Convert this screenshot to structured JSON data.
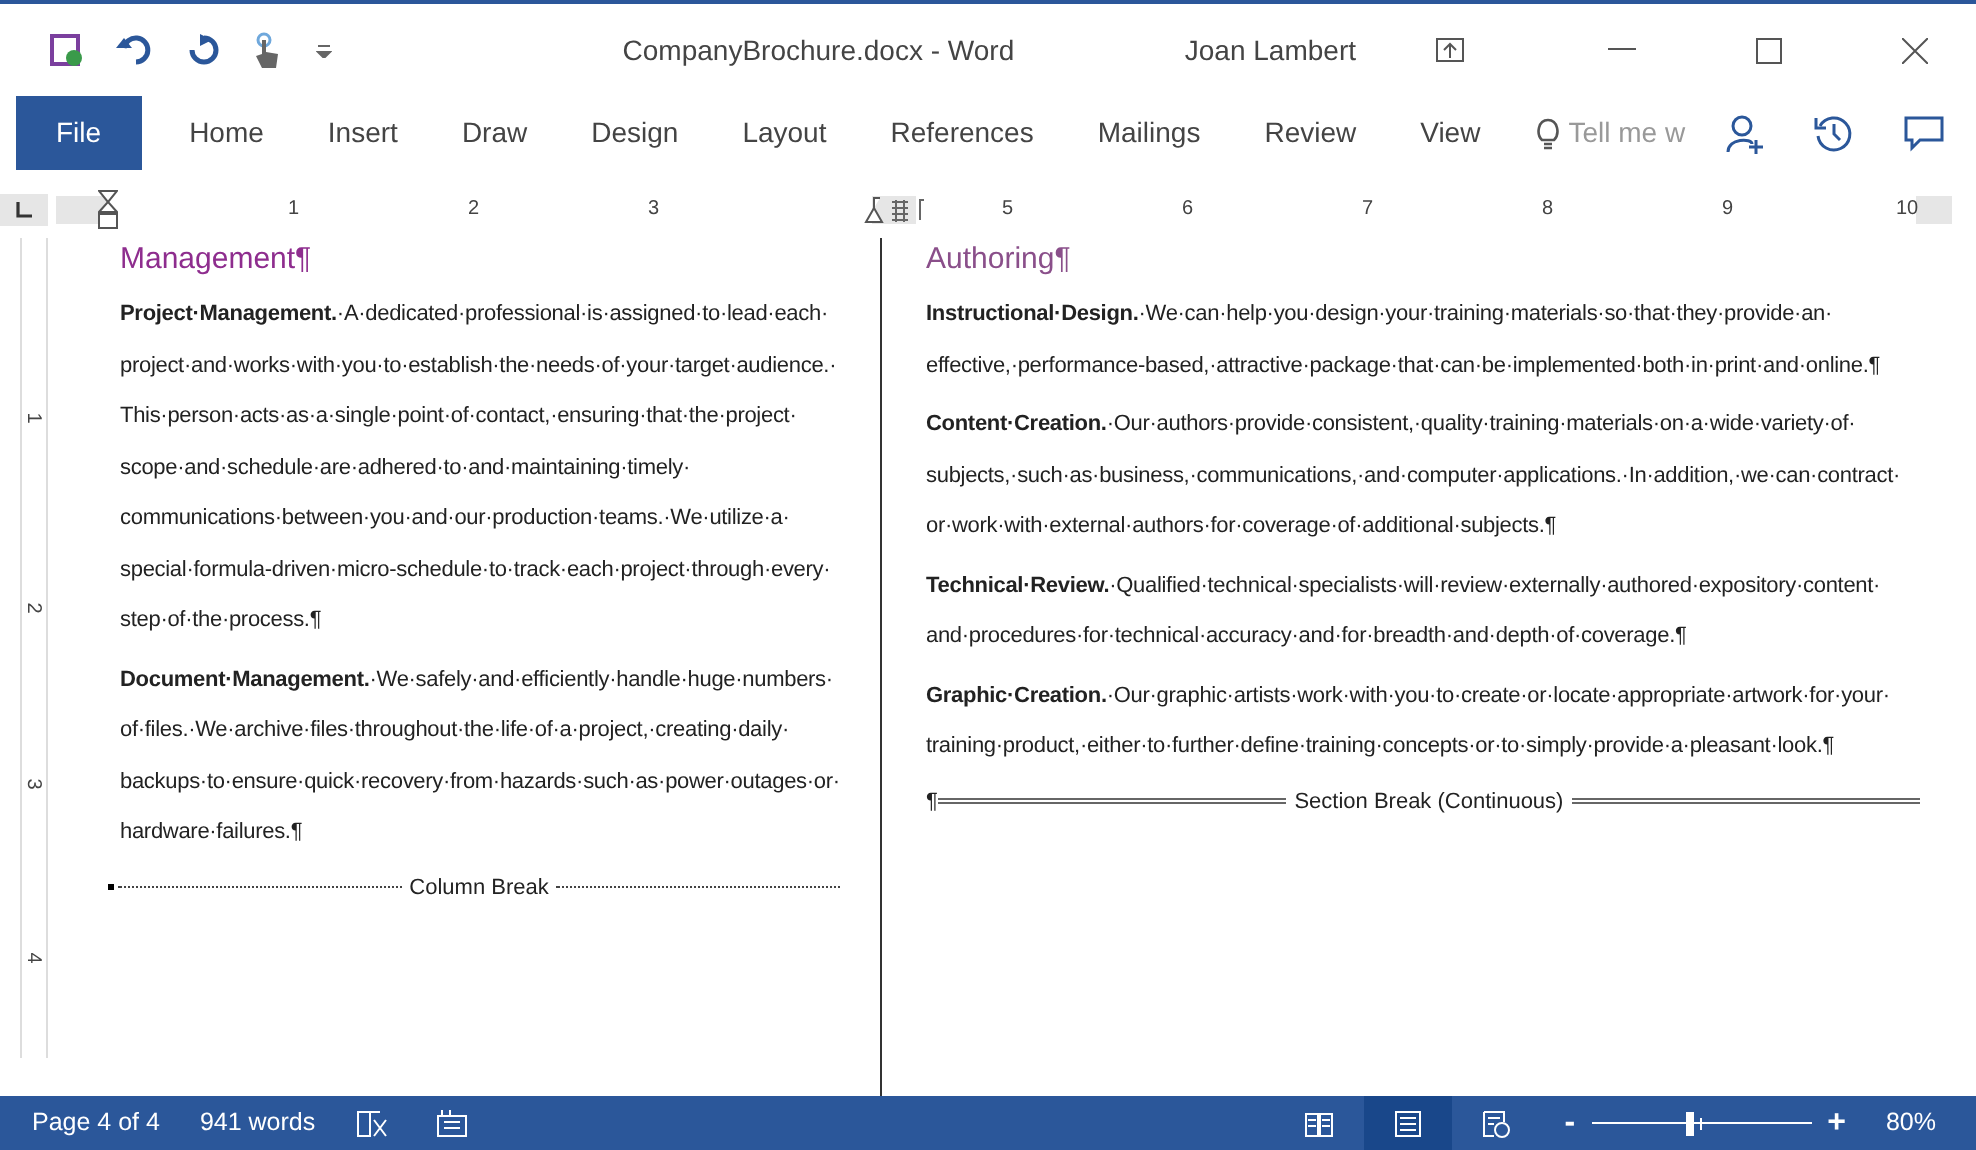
{
  "window": {
    "title": "CompanyBrochure.docx - Word",
    "user": "Joan Lambert"
  },
  "tabs": [
    {
      "label": "File",
      "selected": true
    },
    {
      "label": "Home",
      "selected": false
    },
    {
      "label": "Insert",
      "selected": false
    },
    {
      "label": "Draw",
      "selected": false
    },
    {
      "label": "Design",
      "selected": false
    },
    {
      "label": "Layout",
      "selected": false
    },
    {
      "label": "References",
      "selected": false
    },
    {
      "label": "Mailings",
      "selected": false
    },
    {
      "label": "Review",
      "selected": false
    },
    {
      "label": "View",
      "selected": false
    }
  ],
  "tell_me": {
    "placeholder": "Tell me w"
  },
  "ruler": {
    "numbers": [
      "1",
      "2",
      "3",
      "5",
      "6",
      "7",
      "8",
      "9",
      "10"
    ],
    "vertical_numbers": [
      "1",
      "2",
      "3",
      "4"
    ]
  },
  "columns": [
    {
      "heading": "Management¶",
      "paragraphs": [
        "**Project·Management.**·A·dedicated·professional·is·assigned·to·lead·each·project·and·works·with·you·to·establish·the·needs·of·your·target·audience.·This·person·acts·as·a·single·point·of·contact,·ensuring·that·the·project·scope·and·schedule·are·adhered·to·and·maintaining·timely·communications·between·you·and·our·production·teams.·We·utilize·a·special·formula-driven·micro-schedule·to·track·each·project·through·every·step·of·the·process.¶",
        "**Document·Management.**·We·safely·and·efficiently·handle·huge·numbers·of·files.·We·archive·files·throughout·the·life·of·a·project,·creating·daily·backups·to·ensure·quick·recovery·from·hazards·such·as·power·outages·or·hardware·failures.¶"
      ],
      "break": {
        "kind": "column",
        "label": "Column Break"
      }
    },
    {
      "heading": "Authoring¶",
      "paragraphs": [
        "**Instructional·Design.**·We·can·help·you·design·your·training·materials·so·that·they·provide·an·effective,·performance-based,·attractive·package·that·can·be·implemented·both·in·print·and·online.¶",
        "**Content·Creation.**·Our·authors·provide·consistent,·quality·training·materials·on·a·wide·variety·of·subjects,·such·as·business,·communications,·and·computer·applications.·In·addition,·we·can·contract·or·work·with·external·authors·for·coverage·of·additional·subjects.¶",
        "**Technical·Review.**·Qualified·technical·specialists·will·review·externally·authored·expository·content·and·procedures·for·technical·accuracy·and·for·breadth·and·depth·of·coverage.¶",
        "**Graphic·Creation.**·Our·graphic·artists·work·with·you·to·create·or·locate·appropriate·artwork·for·your·training·product,·either·to·further·define·training·concepts·or·to·simply·provide·a·pleasant·look.¶"
      ],
      "break": {
        "kind": "section",
        "mark": "¶",
        "label": "Section Break (Continuous)"
      }
    }
  ],
  "status_bar": {
    "page": "Page 4 of 4",
    "words": "941 words",
    "views": [
      {
        "kind": "read",
        "selected": false
      },
      {
        "kind": "print",
        "selected": true
      },
      {
        "kind": "web",
        "selected": false
      }
    ],
    "zoom_out": "-",
    "zoom_in": "+",
    "zoom": {
      "level": 0.45
    },
    "zoom_label": "80%"
  }
}
